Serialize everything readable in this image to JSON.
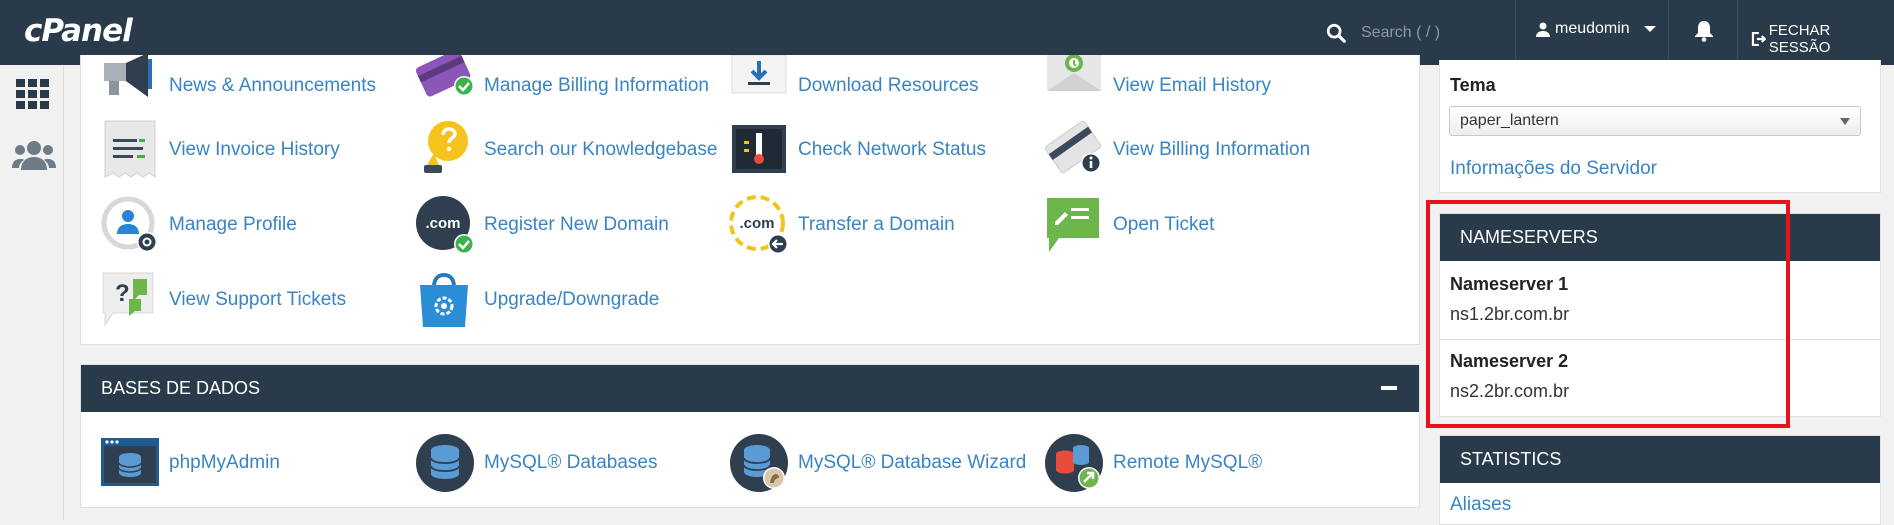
{
  "topbar": {
    "logo": "cPanel",
    "search_placeholder": "Search ( / )",
    "username": "meudomin",
    "logout_label": "FECHAR SESSÃO",
    "icons": [
      "search-icon",
      "user-icon",
      "bell-icon",
      "logout-icon"
    ]
  },
  "leftnav": {
    "icons": [
      "grid-icon",
      "users-icon"
    ]
  },
  "billing": {
    "items": [
      {
        "label": "News & Announcements",
        "icon": "megaphone-icon"
      },
      {
        "label": "Manage Billing Information",
        "icon": "credit-card-icon"
      },
      {
        "label": "Download Resources",
        "icon": "download-icon"
      },
      {
        "label": "View Email History",
        "icon": "email-history-icon"
      },
      {
        "label": "View Invoice History",
        "icon": "invoice-icon"
      },
      {
        "label": "Search our Knowledgebase",
        "icon": "lightbulb-icon"
      },
      {
        "label": "Check Network Status",
        "icon": "network-status-icon"
      },
      {
        "label": "View Billing Information",
        "icon": "billing-info-icon"
      },
      {
        "label": "Manage Profile",
        "icon": "profile-icon"
      },
      {
        "label": "Register New Domain",
        "icon": "register-domain-icon"
      },
      {
        "label": "Transfer a Domain",
        "icon": "transfer-domain-icon"
      },
      {
        "label": "Open Ticket",
        "icon": "open-ticket-icon"
      },
      {
        "label": "View Support Tickets",
        "icon": "support-tickets-icon"
      },
      {
        "label": "Upgrade/Downgrade",
        "icon": "upgrade-bag-icon"
      }
    ]
  },
  "databases": {
    "title": "BASES DE DADOS",
    "items": [
      {
        "label": "phpMyAdmin",
        "icon": "phpmyadmin-icon"
      },
      {
        "label": "MySQL® Databases",
        "icon": "mysql-databases-icon"
      },
      {
        "label": "MySQL® Database Wizard",
        "icon": "mysql-wizard-icon"
      },
      {
        "label": "Remote MySQL®",
        "icon": "remote-mysql-icon"
      }
    ]
  },
  "sidebar": {
    "theme_label": "Tema",
    "theme_value": "paper_lantern",
    "server_info_link": "Informações do Servidor",
    "nameservers": {
      "title": "NAMESERVERS",
      "ns1_label": "Nameserver 1",
      "ns1_value": "ns1.2br.com.br",
      "ns2_label": "Nameserver 2",
      "ns2_value": "ns2.2br.com.br"
    },
    "statistics": {
      "title": "STATISTICS",
      "first_item": "Aliases"
    }
  },
  "colors": {
    "header_bg": "#293a4a",
    "link": "#3a84c4",
    "highlight": "#e8131a"
  }
}
